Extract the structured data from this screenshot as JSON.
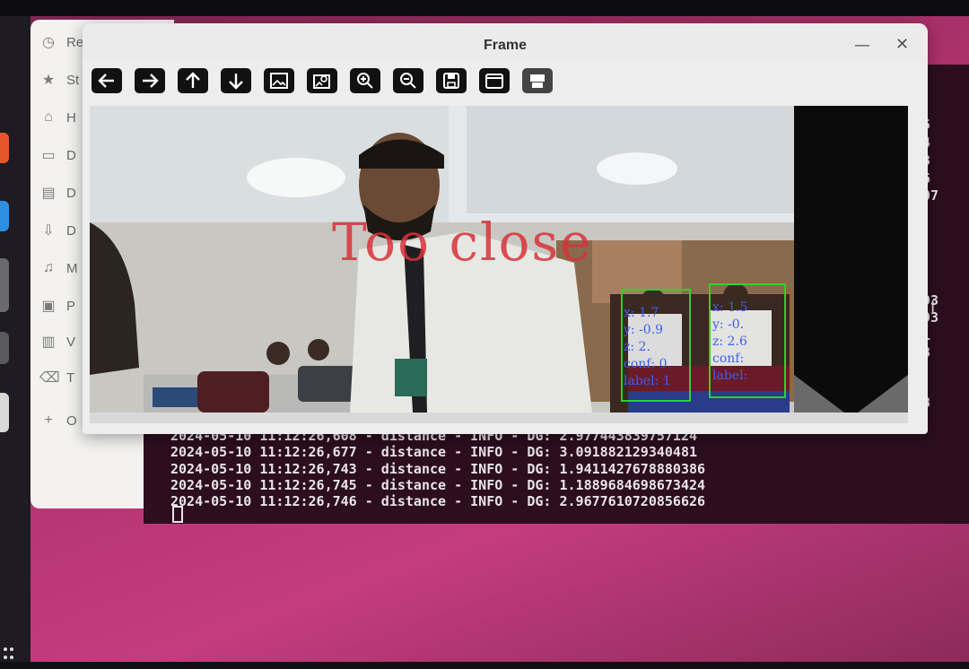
{
  "window": {
    "title": "Frame",
    "minimize_glyph": "—",
    "close_glyph": "✕"
  },
  "toolbar": [
    {
      "name": "pan-left-button",
      "icon": "arrow-left-icon"
    },
    {
      "name": "pan-right-button",
      "icon": "arrow-right-icon"
    },
    {
      "name": "pan-up-button",
      "icon": "arrow-up-icon"
    },
    {
      "name": "pan-down-button",
      "icon": "arrow-down-icon"
    },
    {
      "name": "zoom-fit-button",
      "icon": "image-icon"
    },
    {
      "name": "zoom-original-button",
      "icon": "image-search-icon"
    },
    {
      "name": "zoom-in-button",
      "icon": "zoom-in-icon"
    },
    {
      "name": "zoom-out-button",
      "icon": "zoom-out-icon"
    },
    {
      "name": "save-button",
      "icon": "floppy-icon"
    },
    {
      "name": "properties-button",
      "icon": "window-icon"
    },
    {
      "name": "copy-button",
      "icon": "printer-icon"
    }
  ],
  "view": {
    "overlay_text": "Too close",
    "detections": [
      {
        "lines": "x: 1.7\ny: -0.9\nz: 2.\nconf: 0\nlabel: 1"
      },
      {
        "lines": "x: 1.5\ny: -0.\nz: 2.6\nconf:\nlabel:"
      }
    ]
  },
  "files_sidebar": [
    {
      "icon": "clock-icon",
      "label": "Re"
    },
    {
      "icon": "star-icon",
      "label": "St"
    },
    {
      "icon": "home-icon",
      "label": "H"
    },
    {
      "icon": "folder-icon",
      "label": "D"
    },
    {
      "icon": "document-icon",
      "label": "D"
    },
    {
      "icon": "download-icon",
      "label": "D"
    },
    {
      "icon": "music-icon",
      "label": "M"
    },
    {
      "icon": "picture-icon",
      "label": "P"
    },
    {
      "icon": "video-icon",
      "label": "V"
    },
    {
      "icon": "trash-icon",
      "label": "T"
    },
    {
      "icon": "plus-icon",
      "label": "O"
    }
  ],
  "terminal": {
    "log_lines": [
      "2024-05-10 11:12:26,608 - distance - INFO - DG: 2.977443839757124",
      "2024-05-10 11:12:26,677 - distance - INFO - DG: 3.091882129340481",
      "2024-05-10 11:12:26,743 - distance - INFO - DG: 1.9411427678880386",
      "2024-05-10 11:12:26,745 - distance - INFO - DG: 1.1889684698673424",
      "2024-05-10 11:12:26,746 - distance - INFO - DG: 2.9677610720856626"
    ],
    "side_digits": [
      "5",
      "4",
      "3",
      "6",
      "07",
      "93",
      "93",
      "1",
      "8",
      "8"
    ]
  }
}
